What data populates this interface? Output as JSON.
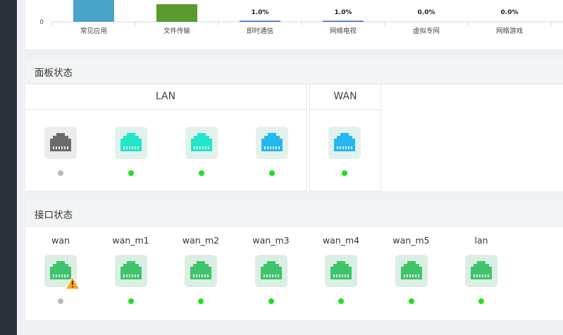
{
  "chart_data": {
    "type": "bar",
    "categories": [
      "常见应用",
      "文件传输",
      "即时通信",
      "网络电视",
      "虚拟专网",
      "网络游戏"
    ],
    "value_labels": [
      "",
      "",
      "1.0%",
      "1.0%",
      "0.0%",
      "0.0%"
    ],
    "values": [
      30,
      22,
      1.0,
      1.0,
      0.0,
      0.0
    ],
    "y_tick_label": "0",
    "colors": [
      "#4aa3c8",
      "#5a9a2e",
      "#3a5fcd",
      "#3a5fcd",
      "#3a5fcd",
      "#3a5fcd"
    ]
  },
  "panel": {
    "title": "面板状态",
    "lan_title": "LAN",
    "wan_title": "WAN",
    "lan_ports": [
      {
        "state": "inactive",
        "color": "#6b6b6b",
        "bg": "#ececec",
        "dot": "#b5b9bf"
      },
      {
        "state": "active",
        "color": "#22e6c8",
        "bg": "#e2f1ec",
        "dot": "#1fe01f"
      },
      {
        "state": "active",
        "color": "#22e6c8",
        "bg": "#e2f1ec",
        "dot": "#1fe01f"
      },
      {
        "state": "active",
        "color": "#25b8f0",
        "bg": "#e2f1ec",
        "dot": "#1fe01f"
      }
    ],
    "wan_ports": [
      {
        "state": "active",
        "color": "#25b8f0",
        "bg": "#e2f1ec",
        "dot": "#1fe01f"
      }
    ]
  },
  "interfaces": {
    "title": "接口状态",
    "items": [
      {
        "name": "wan",
        "warning": true,
        "dot": "#b5b9bf"
      },
      {
        "name": "wan_m1",
        "warning": false,
        "dot": "#1fe01f"
      },
      {
        "name": "wan_m2",
        "warning": false,
        "dot": "#1fe01f"
      },
      {
        "name": "wan_m3",
        "warning": false,
        "dot": "#1fe01f"
      },
      {
        "name": "wan_m4",
        "warning": false,
        "dot": "#1fe01f"
      },
      {
        "name": "wan_m5",
        "warning": false,
        "dot": "#1fe01f"
      },
      {
        "name": "lan",
        "warning": false,
        "dot": "#1fe01f"
      }
    ],
    "port_color": "#3fc46c",
    "port_bg": "#dbeee3"
  }
}
